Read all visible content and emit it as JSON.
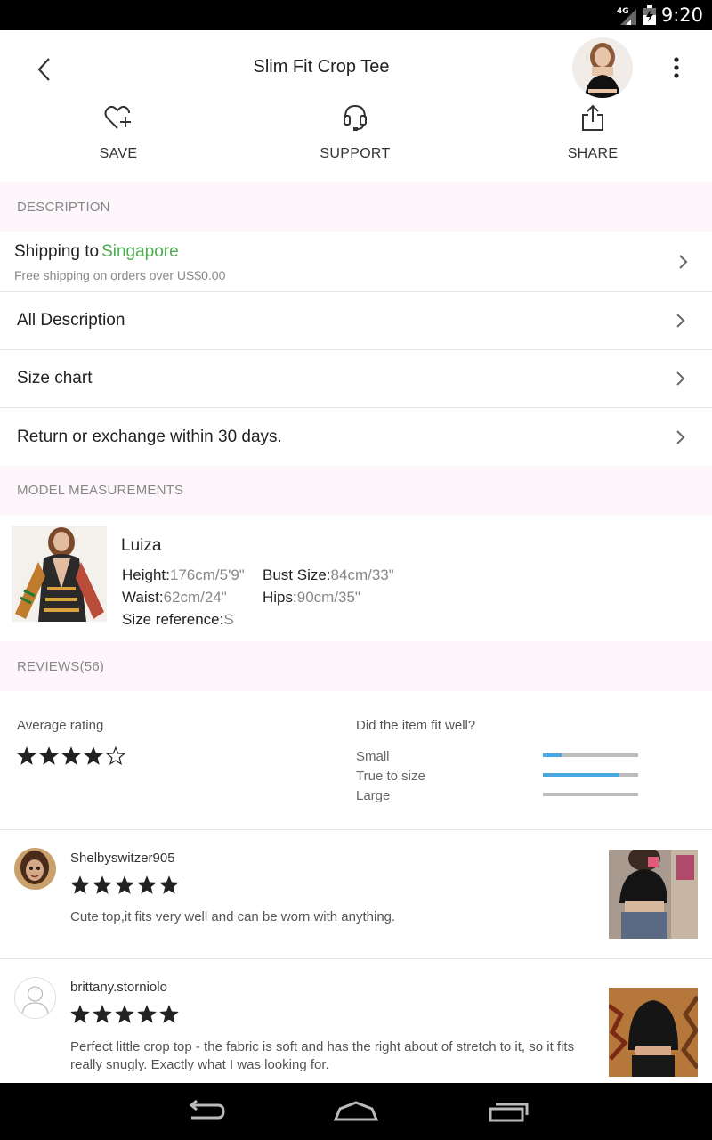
{
  "status_bar": {
    "network": "4G",
    "time": "9:20"
  },
  "header": {
    "title": "Slim Fit Crop Tee"
  },
  "actions": [
    {
      "label": "SAVE",
      "icon": "heart-plus-icon"
    },
    {
      "label": "SUPPORT",
      "icon": "headset-icon"
    },
    {
      "label": "SHARE",
      "icon": "share-icon"
    }
  ],
  "description": {
    "heading": "DESCRIPTION",
    "shipping_prefix": "Shipping to",
    "shipping_country": "Singapore",
    "shipping_note": "Free shipping on orders over US$0.00",
    "rows": [
      {
        "label": "All Description"
      },
      {
        "label": "Size chart"
      },
      {
        "label": "Return or exchange within 30 days."
      }
    ]
  },
  "model": {
    "heading": "MODEL MEASUREMENTS",
    "name": "Luiza",
    "height_label": "Height:",
    "height_value": "176cm/5'9\"",
    "bust_label": "Bust Size:",
    "bust_value": "84cm/33\"",
    "waist_label": "Waist:",
    "waist_value": "62cm/24\"",
    "hips_label": "Hips:",
    "hips_value": "90cm/35\"",
    "size_label": "Size reference:",
    "size_value": "S"
  },
  "reviews": {
    "heading": "REVIEWS(56)",
    "avg_label": "Average rating",
    "avg_rating": 4,
    "fit_question": "Did the item fit well?",
    "fit": [
      {
        "label": "Small",
        "fraction": 0.2
      },
      {
        "label": "True to size",
        "fraction": 0.8
      },
      {
        "label": "Large",
        "fraction": 0.0
      }
    ],
    "items": [
      {
        "user": "Shelbyswitzer905",
        "rating": 5,
        "text": "Cute top,it fits very well and can be worn with anything."
      },
      {
        "user": "brittany.storniolo",
        "rating": 5,
        "text": "Perfect little crop top - the fabric is soft and has the right about of stretch to it, so it fits really snugly. Exactly what I was looking for."
      }
    ]
  },
  "colors": {
    "accent_green": "#4caf50",
    "fit_bar_fill": "#4aa8e0",
    "section_bg": "#fdf7fc"
  }
}
